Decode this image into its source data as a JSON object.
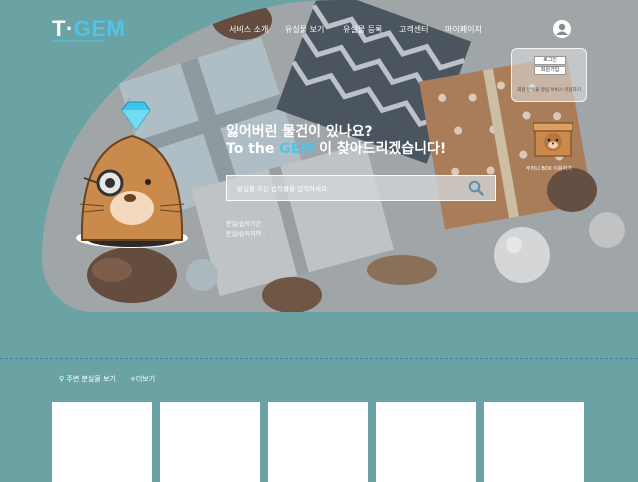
{
  "brand": {
    "logo_pre": "T·",
    "logo_main": "GEM"
  },
  "nav": {
    "items": [
      {
        "label": "서비스 소개"
      },
      {
        "label": "유실물 보기"
      },
      {
        "label": "유실물 등록"
      },
      {
        "label": "고객센터"
      },
      {
        "label": "마이페이지"
      }
    ]
  },
  "account": {
    "login_label": "로그인",
    "signup_label": "회원가입",
    "note": "회원 분실물 알림 서비스 이용하기"
  },
  "box_promo": {
    "caption": "주머니 BOX 이용하기"
  },
  "hero": {
    "headline_line1": "잃어버린 물건이 있나요?",
    "headline_line2_pre": "To the ",
    "headline_line2_gem": "GEM",
    "headline_line2_post": " 이 찾아드리겠습니다!"
  },
  "search": {
    "placeholder": "분실물 또는 습득물을 입력하세요."
  },
  "filters": {
    "period_label": "분실/습득기간 :",
    "area_label": "분실/습득지역 :"
  },
  "nearby": {
    "title": "주변 분실물 보기",
    "more": "+더보기"
  },
  "colors": {
    "page_bg": "#6ba3a5",
    "accent": "#4fc3e8",
    "divider": "#4a7fb5"
  },
  "icons": {
    "avatar": "user-avatar-icon",
    "search": "magnifier-icon",
    "gem": "diamond-icon",
    "box": "box-mascot-icon"
  }
}
